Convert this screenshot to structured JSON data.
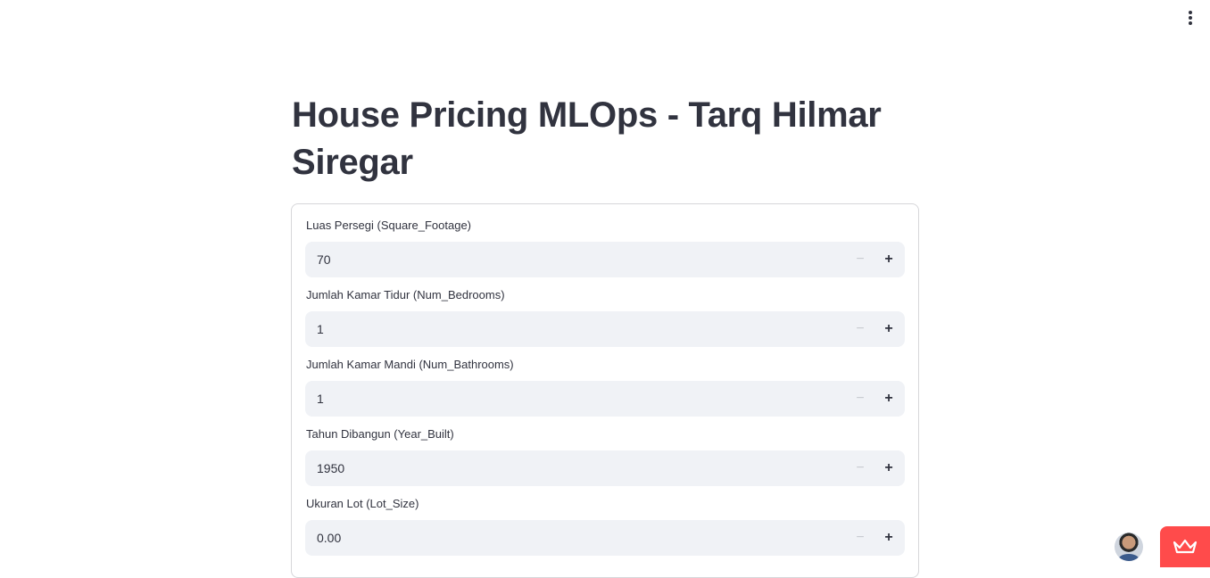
{
  "page": {
    "title": "House Pricing MLOps - Tarq Hilmar Siregar"
  },
  "form": {
    "fields": [
      {
        "label": "Luas Persegi (Square_Footage)",
        "value": "70"
      },
      {
        "label": "Jumlah Kamar Tidur (Num_Bedrooms)",
        "value": "1"
      },
      {
        "label": "Jumlah Kamar Mandi (Num_Bathrooms)",
        "value": "1"
      },
      {
        "label": "Tahun Dibangun (Year_Built)",
        "value": "1950"
      },
      {
        "label": "Ukuran Lot (Lot_Size)",
        "value": "0.00"
      }
    ],
    "decrement_symbol": "−",
    "increment_symbol": "+"
  },
  "icons": {
    "menu": "kebab-menu-icon",
    "avatar": "user-avatar",
    "deploy": "crown-icon"
  },
  "colors": {
    "text": "#31333f",
    "input_bg": "#f0f2f6",
    "border": "#d6d6d9",
    "accent": "#ff4b4b"
  }
}
